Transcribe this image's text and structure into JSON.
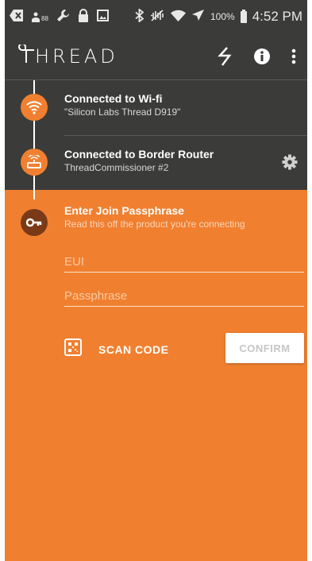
{
  "status_bar": {
    "signal_count": "88",
    "battery_percent": "100%",
    "time": "4:52 PM"
  },
  "app_bar": {
    "brand_name": "HREAD",
    "actions": [
      "flash-icon",
      "info-icon",
      "overflow-menu-icon"
    ]
  },
  "steps": [
    {
      "title": "Connected to Wi-fi",
      "subtitle": "\"Silicon Labs Thread D919\"",
      "icon": "wifi-icon"
    },
    {
      "title": "Connected to Border Router",
      "subtitle": "ThreadCommissioner #2",
      "icon": "router-icon"
    },
    {
      "title": "Enter Join Passphrase",
      "subtitle": "Read this off the product you're connecting",
      "icon": "key-icon"
    }
  ],
  "form": {
    "eui_placeholder": "EUI",
    "eui_value": "",
    "passphrase_placeholder": "Passphrase",
    "passphrase_value": "",
    "scan_label": "SCAN CODE",
    "confirm_label": "CONFIRM"
  },
  "colors": {
    "dark": "#3b3b39",
    "orange": "#f08030",
    "active_icon": "#7a3a17"
  }
}
